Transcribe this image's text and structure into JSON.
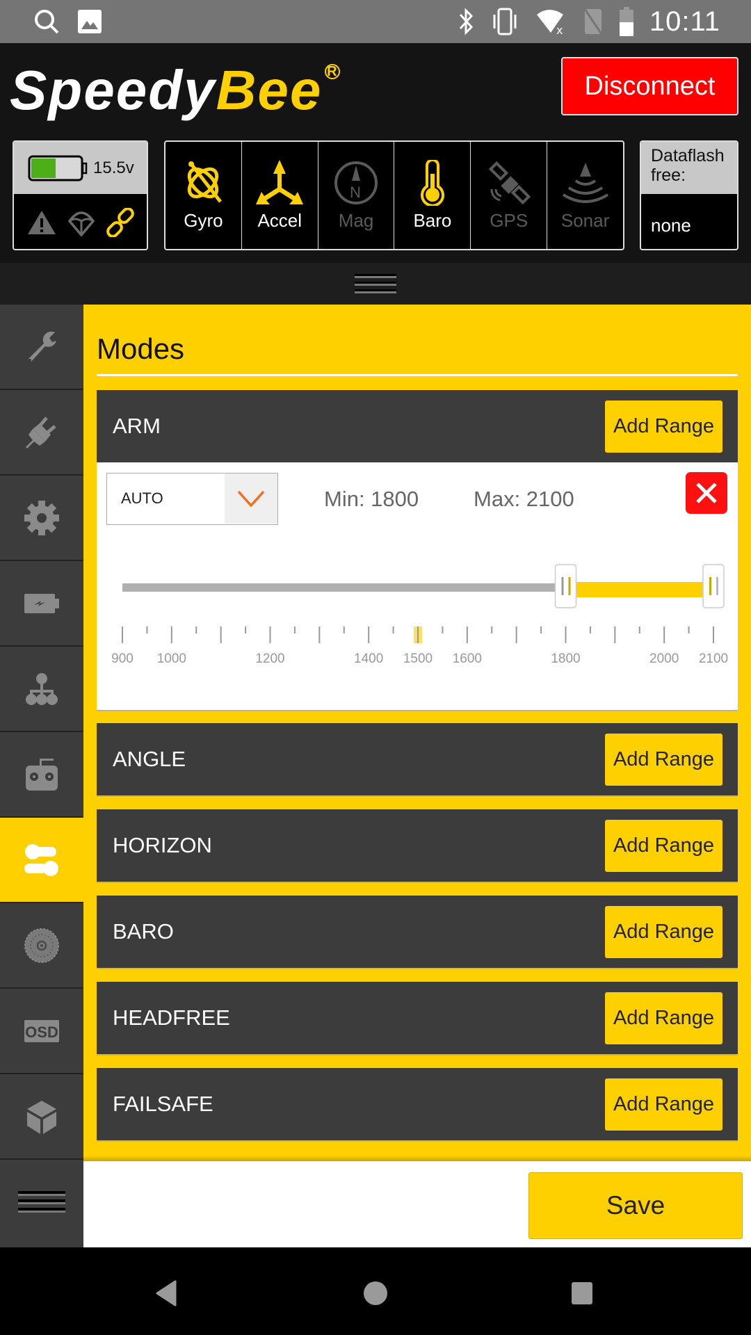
{
  "status_bar": {
    "time": "10:11",
    "left_icons": [
      "search-icon",
      "image-icon"
    ],
    "right_icons": [
      "bluetooth-icon",
      "vibrate-icon",
      "wifi-off-icon",
      "no-sim-icon",
      "battery-icon"
    ]
  },
  "header": {
    "logo_white": "Speedy",
    "logo_yellow": "Bee",
    "logo_reg": "R",
    "disconnect_label": "Disconnect",
    "battery": {
      "voltage": "15.5v",
      "charge_fraction": 0.5,
      "status_icons": [
        "warning-icon",
        "parachute-icon",
        "link-icon"
      ]
    },
    "sensors": [
      {
        "label": "Gyro",
        "icon": "gyro-icon",
        "active": true
      },
      {
        "label": "Accel",
        "icon": "accel-icon",
        "active": true
      },
      {
        "label": "Mag",
        "icon": "compass-icon",
        "active": false
      },
      {
        "label": "Baro",
        "icon": "thermometer-icon",
        "active": true
      },
      {
        "label": "GPS",
        "icon": "satellite-icon",
        "active": false
      },
      {
        "label": "Sonar",
        "icon": "sonar-icon",
        "active": false
      }
    ],
    "dataflash": {
      "label": "Dataflash free:",
      "value": "none"
    }
  },
  "sidebar": {
    "items": [
      {
        "icon": "wrench-icon",
        "active": false
      },
      {
        "icon": "plug-icon",
        "active": false
      },
      {
        "icon": "gear-icon",
        "active": false
      },
      {
        "icon": "battery-charge-icon",
        "active": false
      },
      {
        "icon": "hierarchy-icon",
        "active": false
      },
      {
        "icon": "remote-controller-icon",
        "active": false
      },
      {
        "icon": "toggles-icon",
        "active": true
      },
      {
        "icon": "motor-icon",
        "active": false
      },
      {
        "icon": "osd-icon",
        "active": false,
        "text": "OSD"
      },
      {
        "icon": "cube-icon",
        "active": false
      }
    ]
  },
  "main": {
    "title": "Modes",
    "add_range_label": "Add Range",
    "modes": [
      {
        "name": "ARM",
        "range": {
          "channel": "AUTO",
          "min_label": "Min: 1800",
          "max_label": "Max: 2100",
          "min": 1800,
          "max": 2100,
          "current": 1500,
          "scale_min": 900,
          "scale_max": 2100,
          "tick_labels": [
            "900",
            "1000",
            "1200",
            "1400",
            "1500",
            "1600",
            "1800",
            "2000",
            "2100"
          ]
        }
      },
      {
        "name": "ANGLE"
      },
      {
        "name": "HORIZON"
      },
      {
        "name": "BARO"
      },
      {
        "name": "HEADFREE"
      },
      {
        "name": "FAILSAFE"
      }
    ]
  },
  "footer": {
    "save_label": "Save"
  },
  "colors": {
    "accent": "#ffd000",
    "danger": "#ff0000",
    "panel": "#3c3c3c"
  }
}
